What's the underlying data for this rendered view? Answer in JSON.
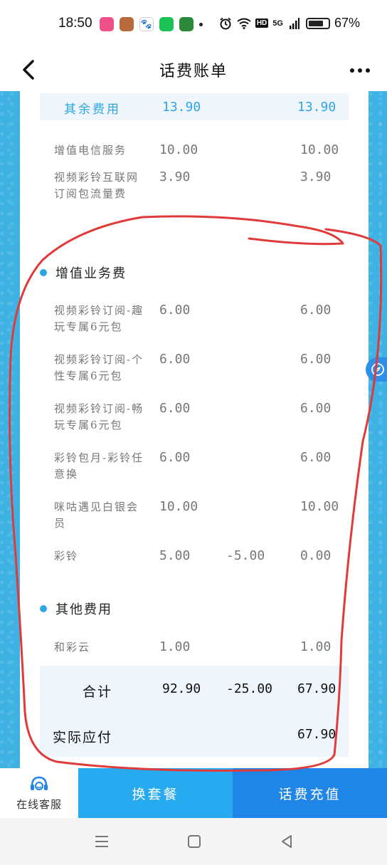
{
  "status_bar": {
    "time": "18:50",
    "battery": "67%",
    "hd": "HD",
    "net": "5G",
    "apps": [
      {
        "name": "app-icon-pink",
        "color": "#f0508a"
      },
      {
        "name": "app-icon-game",
        "color": "#b86a3a"
      },
      {
        "name": "app-icon-paw",
        "color": "#ffffff"
      },
      {
        "name": "app-icon-iqiyi",
        "color": "#19c253"
      },
      {
        "name": "app-icon-oppo",
        "color": "#2a8a3a"
      }
    ]
  },
  "header": {
    "title": "话费账单"
  },
  "colors": {
    "accent": "#2ea6e6",
    "page_bg": "#3fb2e4",
    "plan_button": "#27aaf0",
    "recharge_button": "#1f85e6",
    "annotation": "#e03a3a"
  },
  "subtotal_row": {
    "name": "其余费用",
    "amount": "13.90",
    "actual": "13.90"
  },
  "top_items": [
    {
      "name": "增值电信服务",
      "amount": "10.00",
      "discount": "",
      "actual": "10.00"
    },
    {
      "name": "视频彩铃互联网订阅包流量费",
      "amount": "3.90",
      "discount": "",
      "actual": "3.90"
    }
  ],
  "sections": [
    {
      "title": "增值业务费",
      "items": [
        {
          "name": "视频彩铃订阅-趣玩专属6元包",
          "amount": "6.00",
          "discount": "",
          "actual": "6.00"
        },
        {
          "name": "视频彩铃订阅-个性专属6元包",
          "amount": "6.00",
          "discount": "",
          "actual": "6.00"
        },
        {
          "name": "视频彩铃订阅-畅玩专属6元包",
          "amount": "6.00",
          "discount": "",
          "actual": "6.00"
        },
        {
          "name": "彩铃包月-彩铃任意换",
          "amount": "6.00",
          "discount": "",
          "actual": "6.00"
        },
        {
          "name": "咪咕遇见白银会员",
          "amount": "10.00",
          "discount": "",
          "actual": "10.00"
        },
        {
          "name": "彩铃",
          "amount": "5.00",
          "discount": "-5.00",
          "actual": "0.00"
        }
      ]
    },
    {
      "title": "其他费用",
      "items": [
        {
          "name": "和彩云",
          "amount": "1.00",
          "discount": "",
          "actual": "1.00"
        }
      ]
    }
  ],
  "total": {
    "label": "合计",
    "amount": "92.90",
    "discount": "-25.00",
    "actual": "67.90"
  },
  "payable": {
    "label": "实际应付",
    "actual": "67.90"
  },
  "bottom_bar": {
    "customer_service": "在线客服",
    "change_plan": "换套餐",
    "recharge": "话费充值"
  }
}
